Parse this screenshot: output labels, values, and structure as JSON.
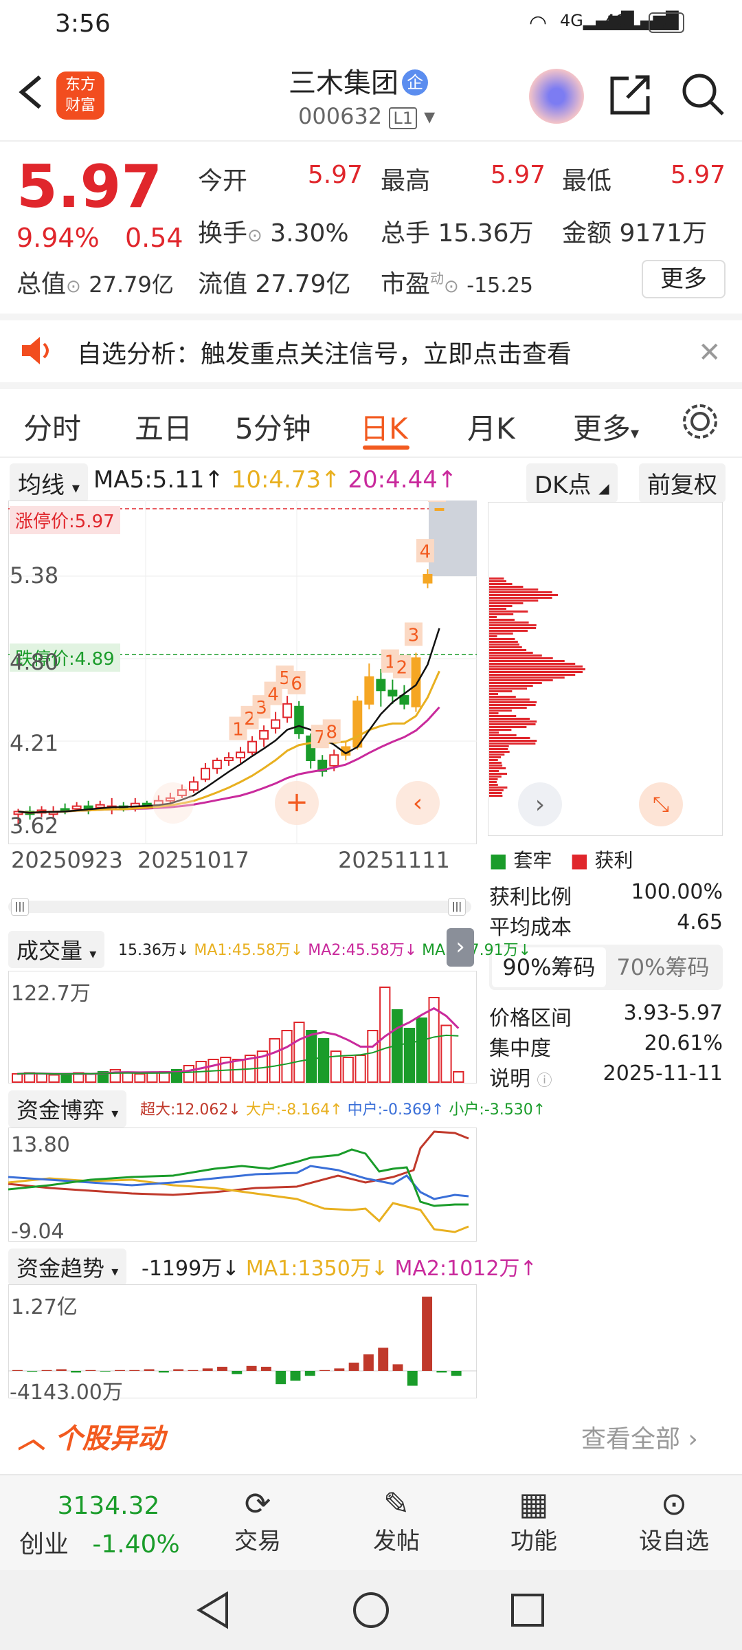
{
  "status": {
    "time": "3:56",
    "battery": "55",
    "net1": "4G",
    "net2": "4G"
  },
  "header": {
    "logo_line1": "东方",
    "logo_line2": "财富",
    "name": "三木集团",
    "badge": "企",
    "code": "000632",
    "level": "L1"
  },
  "quote": {
    "price": "5.97",
    "pct": "9.94%",
    "chg": "0.54",
    "open_label": "今开",
    "open": "5.97",
    "high_label": "最高",
    "high": "5.97",
    "low_label": "最低",
    "low": "5.97",
    "turnover_label": "换手",
    "turnover": "3.30%",
    "volume_label": "总手",
    "volume": "15.36万",
    "amount_label": "金额",
    "amount": "9171万",
    "mcap_label": "总值",
    "mcap": "27.79亿",
    "float_label": "流值",
    "float": "27.79亿",
    "pe_label": "市盈",
    "pe_sup": "动",
    "pe": "-15.25",
    "more": "更多"
  },
  "notice": {
    "text": "自选分析：触发重点关注信号，立即点击查看"
  },
  "tabs": [
    "分时",
    "五日",
    "5分钟",
    "日K",
    "月K",
    "更多"
  ],
  "active_tab": 3,
  "kline": {
    "ma_select": "均线",
    "ma5": "MA5:5.11",
    "ma10": "10:4.73",
    "ma20": "20:4.44",
    "dk": "DK点",
    "fq": "前复权",
    "limit_up": "涨停价:5.97",
    "limit_down": "跌停价:4.89",
    "y_ticks": [
      "5.38",
      "4.80",
      "4.21",
      "3.62"
    ],
    "y_top": "5.97",
    "x_ticks": [
      "20250923",
      "20251017",
      "20251111"
    ]
  },
  "chip_panel": {
    "legend_trap": "套牢",
    "legend_profit": "获利",
    "rows": [
      {
        "label": "获利比例",
        "value": "100.00%"
      },
      {
        "label": "平均成本",
        "value": "4.65"
      }
    ],
    "tab90": "90%筹码",
    "tab70": "70%筹码",
    "rows2": [
      {
        "label": "价格区间",
        "value": "3.93-5.97"
      },
      {
        "label": "集中度",
        "value": "20.61%"
      },
      {
        "label": "说明",
        "value": "2025-11-11"
      }
    ]
  },
  "volume": {
    "select": "成交量",
    "v": "15.36万",
    "ma1": "MA1:45.58万",
    "ma2": "MA2:45.58万",
    "ma3": "MA3:27.91万",
    "ymax": "122.7万"
  },
  "funds": {
    "select": "资金博弈",
    "super": "超大:12.062",
    "big": "大户:-8.164",
    "mid": "中户:-0.369",
    "small": "小户:-3.530",
    "ymax": "13.80",
    "ymin": "-9.04"
  },
  "trend": {
    "select": "资金趋势",
    "v": "-1199万",
    "ma1": "MA1:1350万",
    "ma2": "MA2:1012万",
    "ymax": "1.27亿",
    "ymin": "-4143.00万"
  },
  "anomaly": {
    "title": "个股异动",
    "all": "查看全部"
  },
  "bottom": {
    "index_val": "3134.32",
    "index_name": "创业",
    "index_pct": "-1.40%",
    "btn_trade": "交易",
    "btn_post": "发帖",
    "btn_func": "功能",
    "btn_fav": "设自选"
  },
  "chart_data": {
    "type": "candlestick",
    "ylim": [
      3.62,
      5.97
    ],
    "last_close": 5.97,
    "ma": {
      "MA5": 5.11,
      "MA10": 4.73,
      "MA20": 4.44
    }
  }
}
